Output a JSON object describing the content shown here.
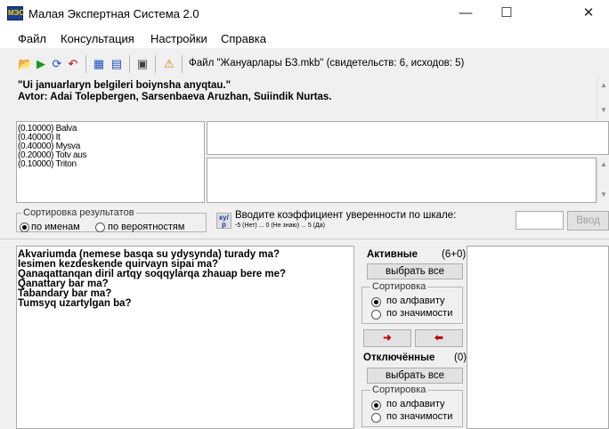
{
  "window": {
    "title": "Малая Экспертная Система 2.0",
    "icon_text": "МЭС",
    "minimize": "—",
    "maximize": "☐",
    "close": "✕"
  },
  "menu": [
    "Файл",
    "Консультация",
    "Настройки",
    "Справка"
  ],
  "toolbar": {
    "file_info": "Файл \"Жануарлары БЗ.mkb\" (свидетельств: 6, исходов: 5)",
    "icons": [
      "open-icon",
      "run-icon",
      "reset-icon",
      "undo-icon",
      "view-icon",
      "save-icon",
      "props-icon",
      "warning-icon"
    ]
  },
  "header": {
    "line1": "\"Ui januarlaryn belgileri boiynsha anyqtau.\"",
    "line2": "Avtor: Adai Tolepbergen, Sarsenbaeva Aruzhan, Suiindik Nurtas."
  },
  "outcomes": [
    "(0.10000) Balva",
    "(0.40000) It",
    "(0.40000) Mysva",
    "(0.20000) Totv aus",
    "(0.10000) Triton"
  ],
  "sorting": {
    "label": "Сортировка результатов",
    "by_name": "по именам",
    "by_probability": "по вероятностям"
  },
  "certainty": {
    "icon_label": "ку/р",
    "prompt": "Вводите коэффициент уверенности по шкале:",
    "scale": "-5 (Нет) ... 0 (Не знаю) ... 5 (Да)",
    "input_value": "",
    "enter_button": "Ввод"
  },
  "questions": [
    "Akvariumda (nemese basqa su ydysynda) turady ma?",
    "Iesimen kezdeskende quirvayn sipai ma?",
    "Qanaqattanqan diril artqy soqqylarqa zhauap bere me?",
    "Qanattary bar ma?",
    "Tabandary bar ma?",
    "Tumsyq uzartylgan ba?"
  ],
  "active": {
    "title": "Активные",
    "count": "(6+0)",
    "select_all": "выбрать все",
    "sort_label": "Сортировка",
    "alpha": "по алфавиту",
    "significance": "по значимости"
  },
  "arrows": {
    "right": "➜",
    "left": "⬅"
  },
  "disabled": {
    "title": "Отключённые",
    "count": "(0)",
    "select_all": "выбрать все",
    "sort_label": "Сортировка",
    "alpha": "по алфавиту",
    "significance": "по значимости"
  },
  "colors": {
    "arrow_red": "#c00000",
    "run_green": "#1a9a1a"
  }
}
